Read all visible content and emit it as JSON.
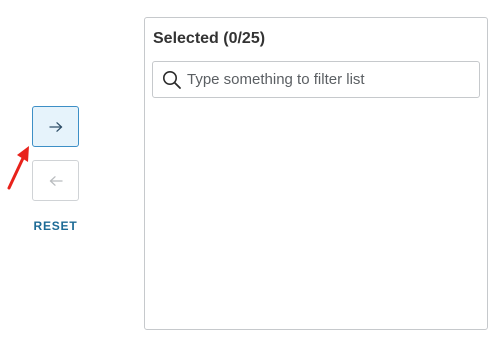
{
  "transfer": {
    "move_right_icon": "arrow-right-icon",
    "move_left_icon": "arrow-left-icon",
    "reset_label": "RESET"
  },
  "selected_panel": {
    "title": "Selected (0/25)",
    "search_placeholder": "Type something to filter list",
    "search_value": "",
    "items": []
  },
  "colors": {
    "accent": "#3d8fc6",
    "active_button_bg": "#e6f3fb",
    "link": "#1d6b96",
    "annotation_arrow": "#e8221b"
  }
}
